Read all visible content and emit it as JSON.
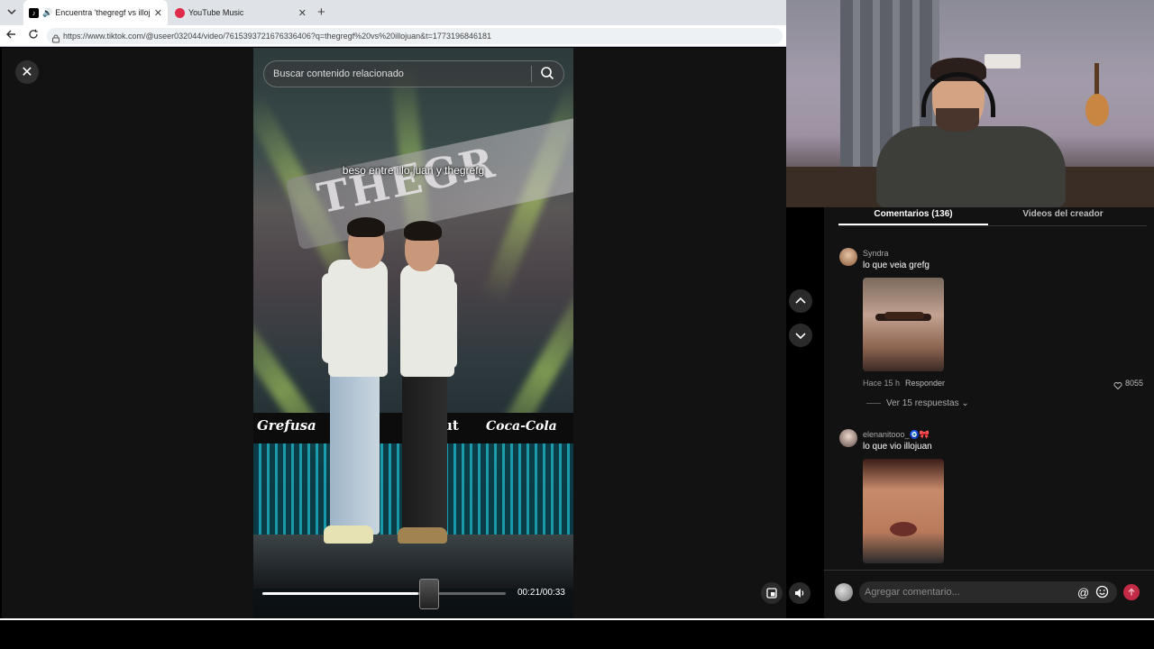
{
  "browser": {
    "tabs": [
      {
        "title": "Encuentra 'thegregf vs illojuan",
        "favicon": "tiktok-icon",
        "audio": true
      },
      {
        "title": "YouTube Music",
        "favicon": "youtube-music-icon"
      }
    ],
    "new_tab_label": "+",
    "url": "https://www.tiktok.com/@useer032044/video/7615393721676336406?q=thegregf%20vs%20illojuan&t=1773196846181"
  },
  "viewer": {
    "search_placeholder": "Buscar contenido relacionado",
    "caption": "beso entre illo juan y thegrefg",
    "timecode": "00:21/00:33",
    "progress": 0.64,
    "brands": [
      "Grefusa",
      "ut",
      "Coca-Cola"
    ],
    "banner_text": "THEGR"
  },
  "comments": {
    "tabs": [
      {
        "label": "Comentarios (136)",
        "active": true
      },
      {
        "label": "Videos del creador",
        "active": false
      }
    ],
    "items": [
      {
        "user": "Syndra",
        "text": "lo que veia grefg",
        "time": "Hace 15 h",
        "reply_label": "Responder",
        "likes": "8055",
        "replies_label": "Ver 15 respuestas"
      },
      {
        "user": "elenanitooo_🧿🎀",
        "text": "lo que vio illojuan"
      }
    ],
    "input_placeholder": "Agregar comentario...",
    "at_symbol": "@"
  },
  "colors": {
    "accent": "#c22b45",
    "background": "#121212",
    "tiktok_brand": "#fe2c55"
  }
}
